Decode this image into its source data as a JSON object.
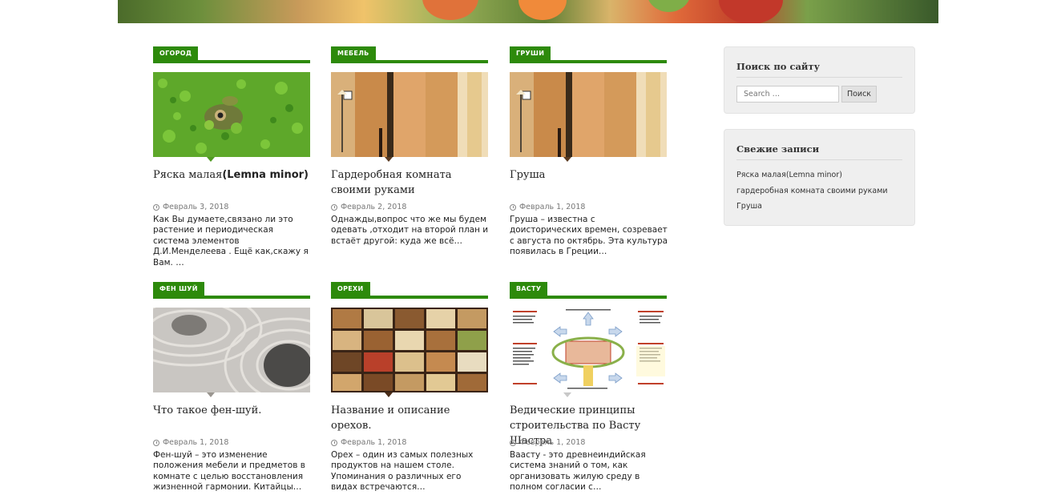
{
  "posts": [
    {
      "category": "ОГОРОД",
      "title_plain": "Ряска малая",
      "title_bold": "(Lemna minor)",
      "date": "Февраль 3, 2018",
      "excerpt": "Как Вы думаете,связано ли это растение и периодическая система элементов Д.И.Менделеева . Ещё как,скажу я Вам.   …",
      "image": "frog-in-duckweed"
    },
    {
      "category": "МЕБЕЛЬ",
      "title_plain": "Гардеробная комната своими руками",
      "title_bold": "",
      "date": "Февраль 2, 2018",
      "excerpt": "Однажды,вопрос что же мы будем одевать ,отходит на второй план и встаёт другой: куда же всё…",
      "image": "wooden-wardrobe"
    },
    {
      "category": "ГРУШИ",
      "title_plain": "Груша",
      "title_bold": "",
      "date": "Февраль 1, 2018",
      "excerpt": "Груша – известна с доисторических времен, созревает с августа по октябрь. Эта культура появилась в Греции…",
      "image": "wooden-wardrobe"
    },
    {
      "category": "ФЕН ШУЙ",
      "title_plain": "Что такое фен-шуй.",
      "title_bold": "",
      "date": "Февраль 1, 2018",
      "excerpt": "Фен-шуй – это изменение положения мебели и предметов в комнате с целью восстановления жизненной гармонии. Китайцы…",
      "image": "zen-stones-sand"
    },
    {
      "category": "ОРЕХИ",
      "title_plain": "Название и описание орехов.",
      "title_bold": "",
      "date": "Февраль 1, 2018",
      "excerpt": "Орех – один из самых полезных продуктов на нашем столе. Упоминания о различных его видах встречаются…",
      "image": "nuts-box"
    },
    {
      "category": "ВАСТУ",
      "title_plain": "Ведические принципы строительства по Васту Шастра",
      "title_bold": "",
      "date": "Февраль 1, 2018",
      "excerpt": " Ваасту  -  это древнеиндийская система знаний о том, как организовать жилую среду в полном согласии с…",
      "image": "vastu-diagram"
    }
  ],
  "sidebar": {
    "search_title": "Поиск по сайту",
    "search_placeholder": "Search …",
    "search_button": "Поиск",
    "recent_title": "Свежие записи",
    "recent": [
      "Ряска малая(Lemna minor)",
      "гардеробная комната своими руками",
      "Груша"
    ]
  },
  "colors": {
    "accent": "#2d8a0b",
    "widget_bg": "#efefef"
  }
}
